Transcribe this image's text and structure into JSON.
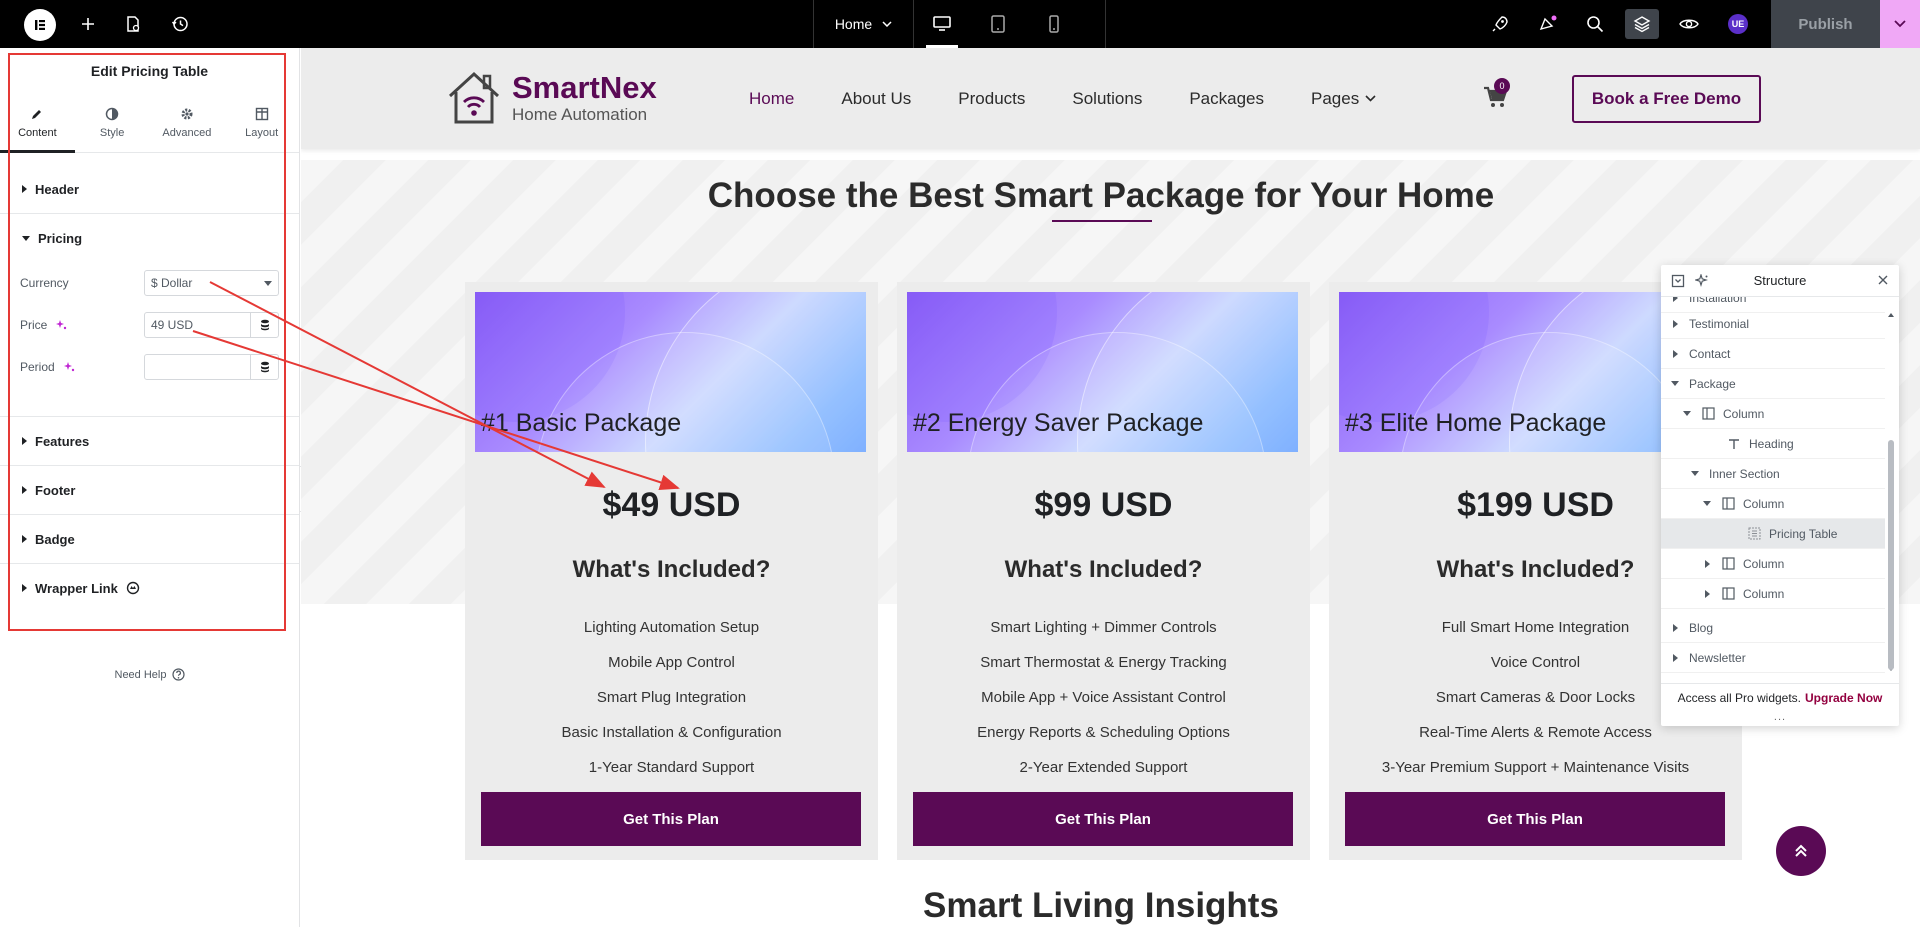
{
  "topbar": {
    "page_selector": "Home",
    "publish_label": "Publish",
    "avatar_initials": "UE"
  },
  "panel": {
    "title": "Edit Pricing Table",
    "tabs": [
      {
        "label": "Content",
        "icon": "pencil-icon"
      },
      {
        "label": "Style",
        "icon": "half-circle-icon"
      },
      {
        "label": "Advanced",
        "icon": "gear-icon"
      },
      {
        "label": "Layout",
        "icon": "layout-icon"
      }
    ],
    "sections": {
      "header": "Header",
      "pricing": "Pricing",
      "features": "Features",
      "footer": "Footer",
      "badge": "Badge",
      "wrapper_link": "Wrapper Link"
    },
    "controls": {
      "currency_label": "Currency",
      "currency_value": "$ Dollar",
      "price_label": "Price",
      "price_value": "49 USD",
      "period_label": "Period",
      "period_value": ""
    },
    "need_help": "Need Help"
  },
  "site": {
    "brand_name": "SmartNex",
    "brand_sub": "Home Automation",
    "nav": [
      "Home",
      "About Us",
      "Products",
      "Solutions",
      "Packages",
      "Pages"
    ],
    "cart_count": "0",
    "cta": "Book a Free Demo",
    "section_title": "Choose the Best Smart Package for Your Home",
    "next_section_title": "Smart Living Insights",
    "cards": [
      {
        "name": "#1 Basic Package",
        "price": "$49 USD",
        "included": "What's Included?",
        "features": [
          "Lighting Automation Setup",
          "Mobile App Control",
          "Smart Plug Integration",
          "Basic Installation & Configuration",
          "1-Year Standard Support"
        ],
        "button": "Get This Plan"
      },
      {
        "name": "#2 Energy Saver Package",
        "price": "$99 USD",
        "included": "What's Included?",
        "features": [
          "Smart Lighting + Dimmer Controls",
          "Smart Thermostat & Energy Tracking",
          "Mobile App + Voice Assistant Control",
          "Energy Reports & Scheduling Options",
          "2-Year Extended Support"
        ],
        "button": "Get This Plan"
      },
      {
        "name": "#3 Elite Home Package",
        "price": "$199 USD",
        "included": "What's Included?",
        "features": [
          "Full Smart Home Integration",
          "Voice Control",
          "Smart Cameras & Door Locks",
          "Real-Time Alerts & Remote Access",
          "3-Year Premium Support + Maintenance Visits"
        ],
        "button": "Get This Plan"
      }
    ]
  },
  "structure": {
    "title": "Structure",
    "items": [
      {
        "label": "Installation",
        "icon": "",
        "arrow": "right"
      },
      {
        "label": "Testimonial",
        "icon": "",
        "arrow": "right"
      },
      {
        "label": "Contact",
        "icon": "",
        "arrow": "right"
      },
      {
        "label": "Package",
        "icon": "",
        "arrow": "down"
      },
      {
        "label": "Column",
        "icon": "column-icon",
        "arrow": "down"
      },
      {
        "label": "Heading",
        "icon": "heading-icon",
        "arrow": ""
      },
      {
        "label": "Inner Section",
        "icon": "",
        "arrow": "down"
      },
      {
        "label": "Column",
        "icon": "column-icon",
        "arrow": "down"
      },
      {
        "label": "Pricing Table",
        "icon": "pricing-table-icon",
        "arrow": ""
      },
      {
        "label": "Column",
        "icon": "column-icon",
        "arrow": "right"
      },
      {
        "label": "Column",
        "icon": "column-icon",
        "arrow": "right"
      },
      {
        "label": "Blog",
        "icon": "",
        "arrow": "right"
      },
      {
        "label": "Newsletter",
        "icon": "",
        "arrow": "right"
      }
    ],
    "footer_text": "Access all Pro widgets.",
    "footer_link": "Upgrade Now",
    "dots": "..."
  },
  "colors": {
    "brand": "#5a0a55",
    "annotation": "#e53935",
    "publish_accent": "#f0a8f6"
  }
}
